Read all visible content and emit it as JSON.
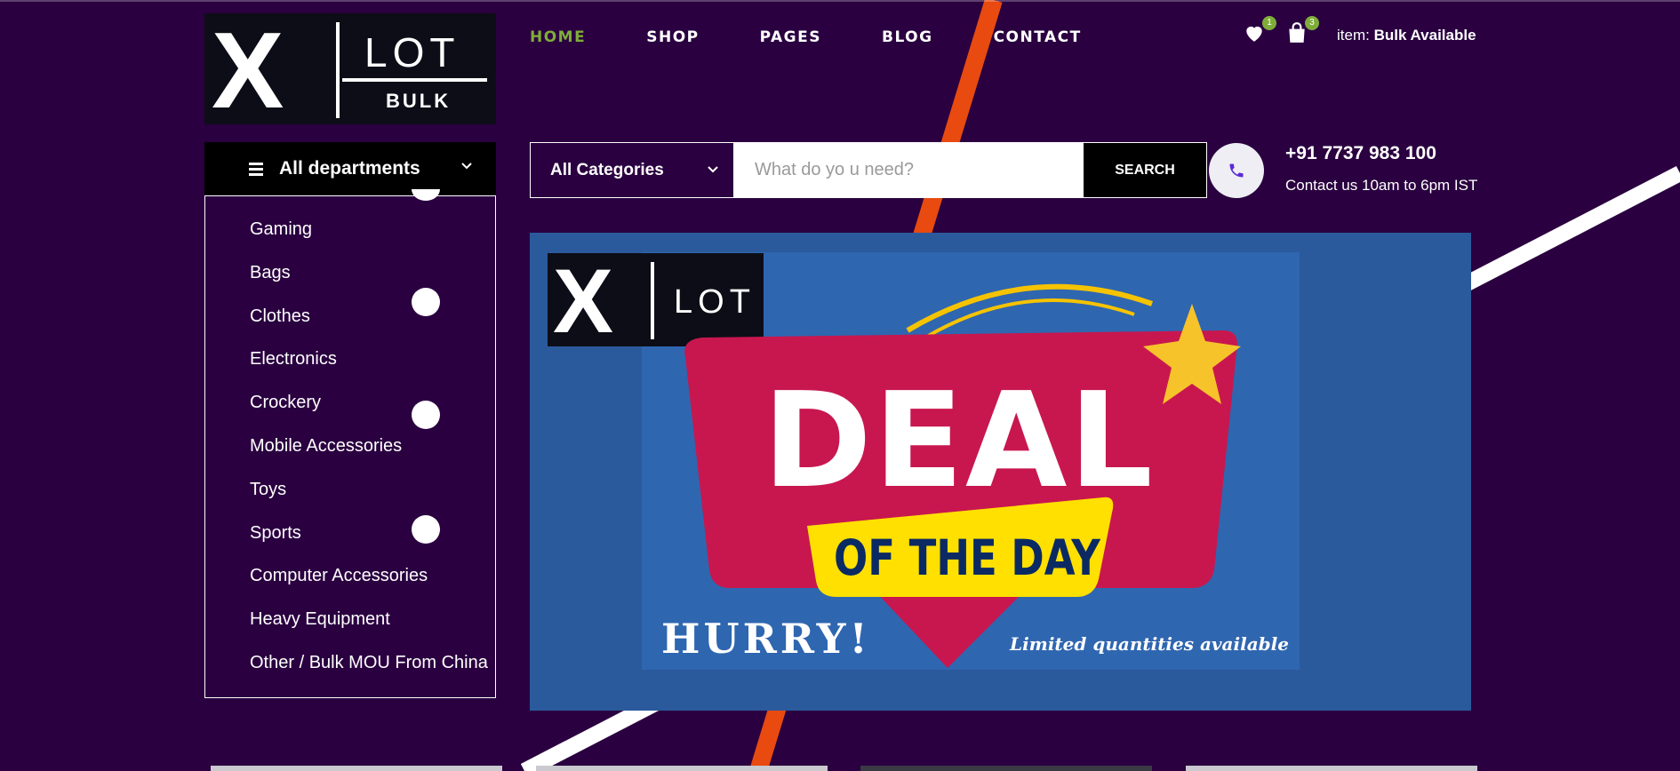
{
  "brand": {
    "logo_letter": "X",
    "logo_word": "LOT",
    "logo_sub": "BULK"
  },
  "nav": {
    "items": [
      {
        "label": "HOME",
        "active": true
      },
      {
        "label": "SHOP",
        "active": false
      },
      {
        "label": "PAGES",
        "active": false
      },
      {
        "label": "BLOG",
        "active": false
      },
      {
        "label": "CONTACT",
        "active": false
      }
    ]
  },
  "header": {
    "wishlist_count": "1",
    "cart_count": "3",
    "item_prefix": "item:",
    "item_value": "Bulk Available"
  },
  "departments": {
    "title": "All departments",
    "items": [
      "Gaming",
      "Bags",
      "Clothes",
      "Electronics",
      "Crockery",
      "Mobile Accessories",
      "Toys",
      "Sports",
      "Computer Accessories",
      "Heavy Equipment",
      "Other / Bulk MOU From China"
    ]
  },
  "search": {
    "category_label": "All Categories",
    "placeholder": "What do yo u need?",
    "button_label": "SEARCH"
  },
  "contact": {
    "phone": "+91 7737 983 100",
    "hours": "Contact us 10am to 6pm IST"
  },
  "banner": {
    "logo_letter": "X",
    "logo_word": "LOT",
    "headline": "DEAL",
    "subheadline": "OF THE DAY",
    "cta": "HURRY!",
    "note": "Limited quantities available"
  },
  "colors": {
    "background": "#2a0040",
    "accent_green": "#7fad39",
    "stripe_orange": "#e84a10",
    "banner_blue": "#2b5a9c",
    "deal_pink": "#c8174f",
    "deal_yellow": "#ffe000",
    "deal_navy": "#0b2a63"
  },
  "icons": {
    "wishlist": "heart-icon",
    "cart": "shopping-bag-icon",
    "menu": "hamburger-icon",
    "phone": "phone-icon",
    "dropdown": "chevron-down-icon"
  }
}
